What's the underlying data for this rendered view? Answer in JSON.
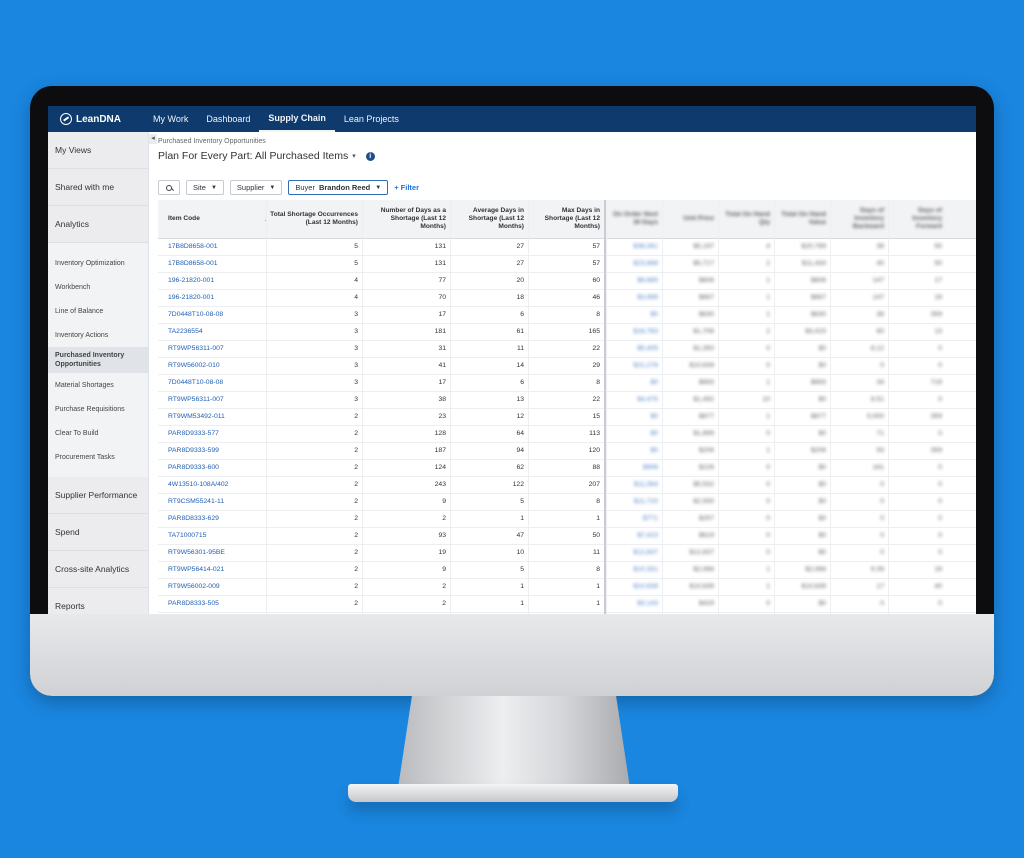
{
  "app": {
    "logo_text": "LeanDNA"
  },
  "nav": [
    "My Work",
    "Dashboard",
    "Supply Chain",
    "Lean Projects"
  ],
  "sidebar": {
    "groups_top": [
      "My Views",
      "Shared with me",
      "Analytics"
    ],
    "analytics_items": [
      "Inventory Optimization",
      "Workbench",
      "Line of Balance",
      "Inventory Actions",
      "Purchased Inventory Opportunities",
      "Material Shortages",
      "Purchase Requisitions",
      "Clear To Build",
      "Procurement Tasks"
    ],
    "groups_bottom": [
      "Supplier Performance",
      "Spend",
      "Cross-site Analytics",
      "Reports"
    ]
  },
  "page": {
    "breadcrumb": "Purchased Inventory Opportunities",
    "title": "Plan For Every Part: All Purchased Items",
    "caret": "▾",
    "info": "i"
  },
  "filters": {
    "site": "Site",
    "supplier": "Supplier",
    "buyer_label": "Buyer",
    "buyer_value": "Brandon Reed",
    "add_filter": "+ Filter",
    "dropdown_glyph": "▼"
  },
  "table": {
    "columns": [
      "Item Code",
      "Total Shortage Occurrences (Last 12 Months)",
      "Number of Days as a Shortage (Last 12 Months)",
      "Average Days in Shortage (Last 12 Months)",
      "Max Days in Shortage (Last 12 Months)",
      "On Order Next 30 Days",
      "Unit Price",
      "Total On Hand Qty",
      "Total On Hand Value",
      "Days of Inventory Backward",
      "Days of Inventory Forward"
    ],
    "sort_glyph": "↓",
    "rows": [
      [
        "17B8D8658-001",
        "5",
        "131",
        "27",
        "57",
        "$36,061",
        "$5,197",
        "4",
        "$20,789",
        "36",
        "50"
      ],
      [
        "17B8D8658-001",
        "5",
        "131",
        "27",
        "57",
        "$23,868",
        "$5,717",
        "2",
        "$11,434",
        "40",
        "50"
      ],
      [
        "196-21820-001",
        "4",
        "77",
        "20",
        "60",
        "$6,665",
        "$606",
        "1",
        "$606",
        "147",
        "17"
      ],
      [
        "196-21820-001",
        "4",
        "70",
        "18",
        "46",
        "$3,999",
        "$667",
        "1",
        "$667",
        "147",
        "19"
      ],
      [
        "7D0448T10-08-08",
        "3",
        "17",
        "6",
        "8",
        "$0",
        "$630",
        "1",
        "$630",
        "36",
        "359"
      ],
      [
        "TA2236554",
        "3",
        "181",
        "61",
        "165",
        "$16,763",
        "$1,708",
        "2",
        "$3,415",
        "60",
        "13"
      ],
      [
        "RT9WP56311-007",
        "3",
        "31",
        "11",
        "22",
        "$5,405",
        "$1,350",
        "0",
        "$0",
        "8.12",
        "0"
      ],
      [
        "RT9W56002-010",
        "3",
        "41",
        "14",
        "29",
        "$21,278",
        "$10,639",
        "0",
        "$0",
        "0",
        "0"
      ],
      [
        "7D0448T10-08-08",
        "3",
        "17",
        "6",
        "8",
        "$0",
        "$693",
        "1",
        "$693",
        "34",
        "719"
      ],
      [
        "RT9WP56311-007",
        "3",
        "38",
        "13",
        "22",
        "$4,475",
        "$1,492",
        "10",
        "$0",
        "8.51",
        "0"
      ],
      [
        "RT9WM53492-011",
        "2",
        "23",
        "12",
        "15",
        "$0",
        "$877",
        "1",
        "$877",
        "5,000",
        "359"
      ],
      [
        "PAR8D9333-577",
        "2",
        "128",
        "64",
        "113",
        "$0",
        "$1,899",
        "0",
        "$0",
        "71",
        "0"
      ],
      [
        "PAR8D9333-599",
        "2",
        "187",
        "94",
        "120",
        "$0",
        "$206",
        "1",
        "$206",
        "93",
        "359"
      ],
      [
        "PAR8D9333-600",
        "2",
        "124",
        "62",
        "88",
        "$906",
        "$226",
        "0",
        "$0",
        "181",
        "0"
      ],
      [
        "4W13510-108A/402",
        "2",
        "243",
        "122",
        "207",
        "$11,064",
        "$5,532",
        "0",
        "$0",
        "0",
        "0"
      ],
      [
        "RT9CSM55241-11",
        "2",
        "9",
        "5",
        "8",
        "$11,720",
        "$2,930",
        "0",
        "$0",
        "0",
        "0"
      ],
      [
        "PAR8D8333-629",
        "2",
        "2",
        "1",
        "1",
        "$771",
        "$257",
        "0",
        "$0",
        "0",
        "0"
      ],
      [
        "TA71000715",
        "2",
        "93",
        "47",
        "50",
        "$7,423",
        "$619",
        "0",
        "$0",
        "0",
        "0"
      ],
      [
        "RT9W56301-95BE",
        "2",
        "19",
        "10",
        "11",
        "$12,837",
        "$12,837",
        "0",
        "$0",
        "0",
        "0"
      ],
      [
        "RT9WP56414-021",
        "2",
        "9",
        "5",
        "8",
        "$10,331",
        "$2,066",
        "1",
        "$2,066",
        "9.39",
        "19"
      ],
      [
        "RT9W56002-009",
        "2",
        "2",
        "1",
        "1",
        "$10,639",
        "$10,639",
        "1",
        "$10,639",
        "17",
        "40"
      ],
      [
        "PAR8D8333-505",
        "2",
        "2",
        "1",
        "1",
        "$3,143",
        "$429",
        "0",
        "$0",
        "0",
        "0"
      ],
      [
        "RT9W56004-016",
        "2",
        "16",
        "8",
        "15",
        "$9,281",
        "$9,281",
        "0",
        "$0",
        "0",
        "0"
      ]
    ]
  },
  "colors": {
    "nav_bg": "#0f3a6d",
    "link": "#1f5fb4",
    "accent": "#1a73d9",
    "backdrop": "#1a86e0"
  }
}
